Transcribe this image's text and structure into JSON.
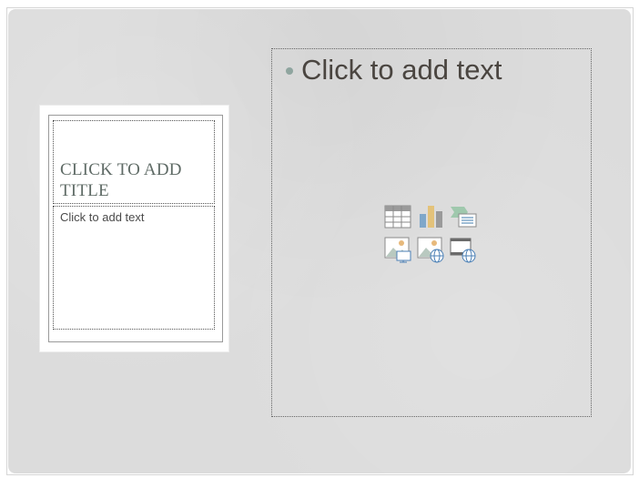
{
  "slide": {
    "left_layout": {
      "title_placeholder": "CLICK TO ADD\nTITLE",
      "text_placeholder": "Click to add text"
    },
    "content_placeholder": {
      "bullet_text": "Click to add text",
      "insert_icons": [
        "insert-table-icon",
        "insert-chart-icon",
        "insert-smartart-icon",
        "insert-picture-icon",
        "insert-online-picture-icon",
        "insert-video-icon"
      ]
    }
  },
  "colors": {
    "slide_background": "#dcdcdc",
    "title_text": "#5f6b66",
    "bullet": "#8fa59f",
    "body_text": "#4a4540"
  }
}
